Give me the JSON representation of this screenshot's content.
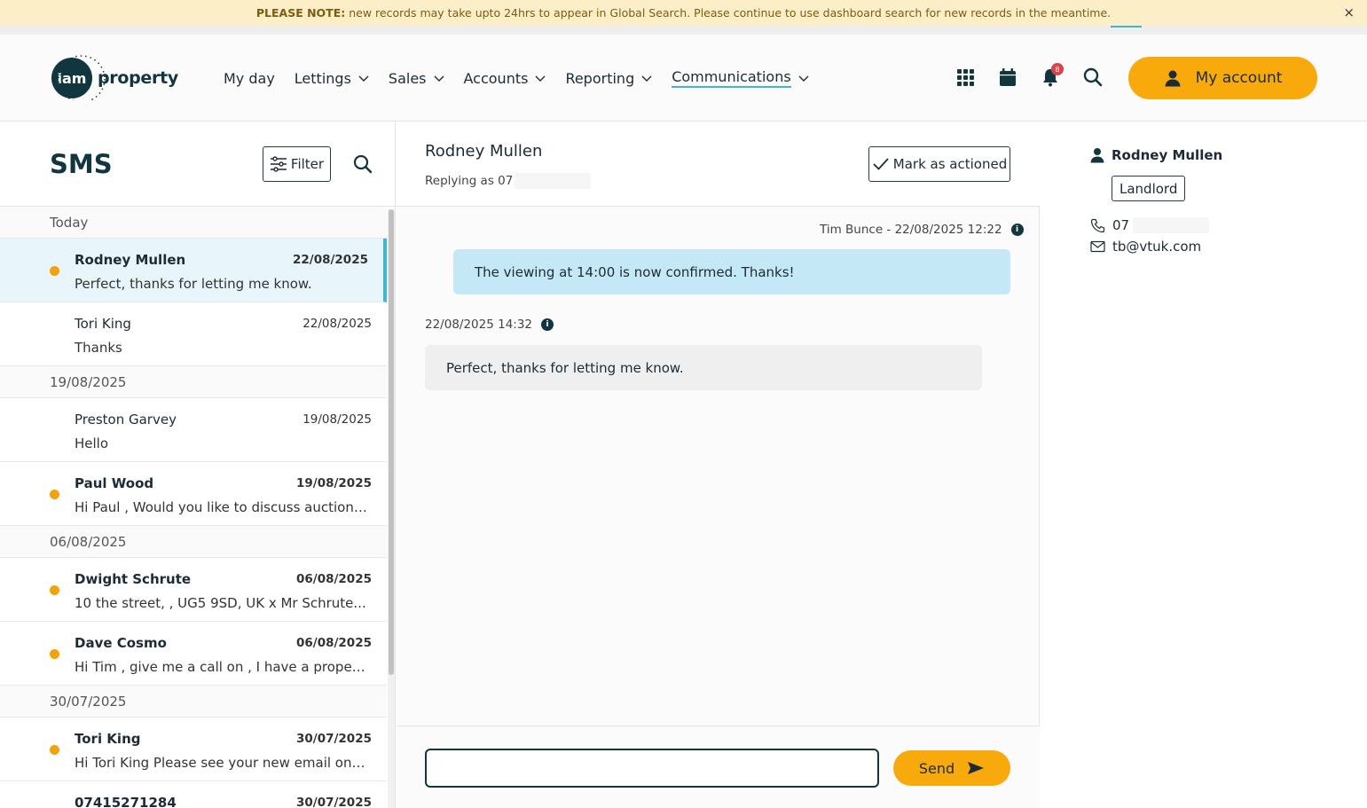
{
  "banner": {
    "note_label": "PLEASE NOTE:",
    "text": "new records may take upto 24hrs to appear in Global Search. Please continue to use dashboard search for new records in the meantime.",
    "close": "×"
  },
  "header": {
    "logo_badge": "iam",
    "logo_text": "property",
    "nav": [
      {
        "label": "My day"
      },
      {
        "label": "Lettings"
      },
      {
        "label": "Sales"
      },
      {
        "label": "Accounts"
      },
      {
        "label": "Reporting"
      },
      {
        "label": "Communications"
      }
    ],
    "notification_count": "8",
    "account_label": "My account",
    "icons": [
      "apps-grid-icon",
      "calendar-icon",
      "bell-icon",
      "search-icon",
      "user-icon"
    ]
  },
  "sms": {
    "title": "SMS",
    "filter_label": "Filter",
    "groups": [
      {
        "label": "Today",
        "items": [
          {
            "name": "Rodney Mullen",
            "date": "22/08/2025",
            "preview": "Perfect, thanks for letting me know.",
            "unread": true,
            "selected": true
          },
          {
            "name": "Tori King",
            "date": "22/08/2025",
            "preview": "Thanks",
            "unread": false,
            "selected": false
          }
        ]
      },
      {
        "label": "19/08/2025",
        "items": [
          {
            "name": "Preston Garvey",
            "date": "19/08/2025",
            "preview": "Hello",
            "unread": false,
            "selected": false
          },
          {
            "name": "Paul Wood",
            "date": "19/08/2025",
            "preview": "Hi Paul , Would you like to discuss auction?...",
            "unread": true,
            "selected": false
          }
        ]
      },
      {
        "label": "06/08/2025",
        "items": [
          {
            "name": "Dwight Schrute",
            "date": "06/08/2025",
            "preview": "10 the street, , UG5 9SD, UK x Mr Schrute...",
            "unread": true,
            "selected": false
          },
          {
            "name": "Dave Cosmo",
            "date": "06/08/2025",
            "preview": "Hi Tim , give me a call on , I have a property yo...",
            "unread": true,
            "selected": false
          }
        ]
      },
      {
        "label": "30/07/2025",
        "items": [
          {
            "name": "Tori King",
            "date": "30/07/2025",
            "preview": "Hi Tori King Please see your new email on our...",
            "unread": true,
            "selected": false
          },
          {
            "name": "07415271284",
            "date": "30/07/2025",
            "preview": "",
            "unread": true,
            "selected": false
          }
        ]
      }
    ]
  },
  "conversation": {
    "contact_name": "Rodney Mullen",
    "replying_as": "Replying as 07",
    "mark_label": "Mark as actioned",
    "outgoing_meta": "Tim Bunce - 22/08/2025 12:22",
    "outgoing_text": "The viewing at 14:00 is now confirmed. Thanks!",
    "incoming_meta": "22/08/2025 14:32",
    "incoming_text": "Perfect, thanks for letting me know.",
    "input_placeholder": "",
    "send_label": "Send"
  },
  "contact": {
    "name": "Rodney Mullen",
    "tag": "Landlord",
    "phone": "07",
    "email": "tb@vtuk.com"
  },
  "colors": {
    "accent": "#f8a90c",
    "brand": "#12363f",
    "highlight": "#3fb6cf",
    "unread_dot": "#f0a30a",
    "outgoing_bubble": "#c5e8f7"
  }
}
